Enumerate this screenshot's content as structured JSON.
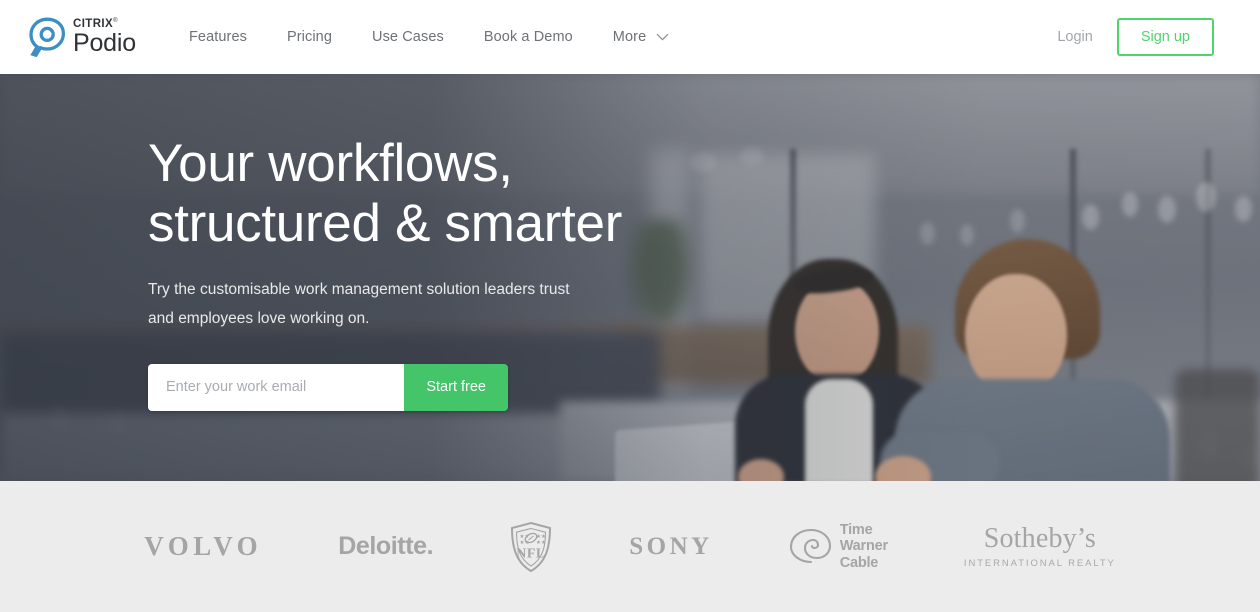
{
  "header": {
    "brand": {
      "citrix": "CITRIX",
      "citrix_tm": "®",
      "podio": "Podio",
      "mark_icon": "podio-pin-logo-icon"
    },
    "nav": [
      {
        "label": "Features"
      },
      {
        "label": "Pricing"
      },
      {
        "label": "Use Cases"
      },
      {
        "label": "Book a Demo"
      },
      {
        "label": "More",
        "icon": "chevron-down-icon"
      }
    ],
    "login_label": "Login",
    "signup_label": "Sign up",
    "accent_green": "#4fd46a",
    "text_gray": "#6e7176"
  },
  "hero": {
    "title_line1": "Your workflows,",
    "title_line2": "structured & smarter",
    "subtitle_line1": "Try the customisable work management solution leaders trust and",
    "subtitle_line2": "employees love working on.",
    "email_placeholder": "Enter your work email",
    "email_value": "",
    "submit_label": "Start free",
    "button_green": "#45c569",
    "background_image": "office-photo-two-colleagues-at-laptop"
  },
  "logo_strip": {
    "background": "#ececec",
    "logo_color": "#a5a5a5",
    "logos": [
      {
        "name": "volvo",
        "text": "VOLVO"
      },
      {
        "name": "deloitte",
        "text": "Deloitte."
      },
      {
        "name": "nfl",
        "text": "NFL",
        "icon": "nfl-shield-icon"
      },
      {
        "name": "sony",
        "text": "SONY"
      },
      {
        "name": "time-warner-cable",
        "line1": "Time",
        "line2": "Warner",
        "line3": "Cable",
        "icon": "twc-eye-icon"
      },
      {
        "name": "sothebys",
        "text": "Sotheby’s",
        "subtext": "INTERNATIONAL REALTY"
      }
    ]
  }
}
